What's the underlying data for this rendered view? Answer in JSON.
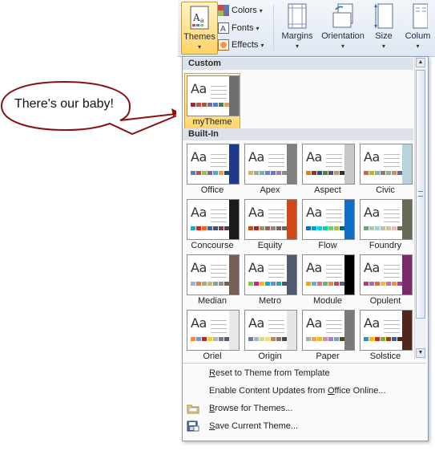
{
  "ribbon": {
    "themes_label": "Themes",
    "colors_label": "Colors",
    "fonts_label": "Fonts",
    "effects_label": "Effects",
    "margins_label": "Margins",
    "orientation_label": "Orientation",
    "size_label": "Size",
    "columns_label": "Colum"
  },
  "gallery": {
    "custom_header": "Custom",
    "builtin_header": "Built-In",
    "custom": [
      {
        "name": "myTheme",
        "strip": "#6e6e6e",
        "swatches": [
          "#9b2c2c",
          "#c0504d",
          "#9b5b3c",
          "#8064a2",
          "#4f81bd",
          "#4a7a55",
          "#e0a060"
        ]
      }
    ],
    "builtin": [
      {
        "name": "Office",
        "strip": "#1f3a8a",
        "swatches": [
          "#4f81bd",
          "#c0504d",
          "#9bbb59",
          "#8064a2",
          "#4bacc6",
          "#f79646",
          "#1f497d"
        ]
      },
      {
        "name": "Apex",
        "strip": "#7f7f7f",
        "swatches": [
          "#ceb966",
          "#9cb084",
          "#6bb1c9",
          "#6585cf",
          "#7e6bc9",
          "#a379bb",
          "#8a8a8a"
        ]
      },
      {
        "name": "Aspect",
        "strip": "#c8c8c8",
        "swatches": [
          "#f07f09",
          "#9f2936",
          "#1b587c",
          "#4e8542",
          "#604878",
          "#c19859",
          "#323232"
        ]
      },
      {
        "name": "Civic",
        "strip": "#b9d3dc",
        "swatches": [
          "#d16349",
          "#ccb400",
          "#8cadae",
          "#8c7b70",
          "#8fb08c",
          "#d19049",
          "#646b86"
        ]
      },
      {
        "name": "Concourse",
        "strip": "#1a1a1a",
        "swatches": [
          "#2da2bf",
          "#da1f28",
          "#eb641b",
          "#39639d",
          "#474b78",
          "#7d3c4a",
          "#464646"
        ]
      },
      {
        "name": "Equity",
        "strip": "#d34817",
        "swatches": [
          "#d34817",
          "#9b2d1f",
          "#a28e6a",
          "#956251",
          "#918485",
          "#855d5d",
          "#696464"
        ]
      },
      {
        "name": "Flow",
        "strip": "#0f6fc6",
        "swatches": [
          "#0f6fc6",
          "#009dd9",
          "#0bd0d9",
          "#10cf9b",
          "#7cca62",
          "#a5c249",
          "#04617b"
        ]
      },
      {
        "name": "Foundry",
        "strip": "#676a55",
        "swatches": [
          "#72a376",
          "#b0ccb0",
          "#a8cdd7",
          "#c0beaf",
          "#cec597",
          "#e8b7b7",
          "#676a55"
        ]
      },
      {
        "name": "Median",
        "strip": "#775f55",
        "swatches": [
          "#94b6d2",
          "#dd8047",
          "#a5ab81",
          "#d8b25c",
          "#7ba79d",
          "#968c8c",
          "#775f55"
        ]
      },
      {
        "name": "Metro",
        "strip": "#4e5b6f",
        "swatches": [
          "#7fd13b",
          "#ea157a",
          "#feb80a",
          "#00addc",
          "#738ac8",
          "#1ab39f",
          "#4e5b6f"
        ]
      },
      {
        "name": "Module",
        "strip": "#000000",
        "swatches": [
          "#f0ad00",
          "#60b5cc",
          "#e66c7d",
          "#6bb76d",
          "#e88651",
          "#c64847",
          "#5a6378"
        ]
      },
      {
        "name": "Opulent",
        "strip": "#7a2a6a",
        "swatches": [
          "#b83d68",
          "#ac66bb",
          "#de6c36",
          "#f9b639",
          "#cf6da4",
          "#fa8d3d",
          "#b13f9a"
        ]
      },
      {
        "name": "Oriel",
        "strip": "#e8e8e8",
        "swatches": [
          "#fe8637",
          "#7598d9",
          "#b32c16",
          "#f5cd2d",
          "#aebad5",
          "#777c84",
          "#575f6d"
        ]
      },
      {
        "name": "Origin",
        "strip": "#e6e6e6",
        "swatches": [
          "#727ca3",
          "#9fb8cd",
          "#d2da7a",
          "#fada7a",
          "#b88472",
          "#8e736a",
          "#464653"
        ]
      },
      {
        "name": "Paper",
        "strip": "#7a7a7a",
        "swatches": [
          "#a5b592",
          "#f3a447",
          "#e7bc29",
          "#d092a7",
          "#9c85c0",
          "#809ec2",
          "#444d26"
        ]
      },
      {
        "name": "Solstice",
        "strip": "#4f271c",
        "swatches": [
          "#3891a7",
          "#feb80a",
          "#c32d2e",
          "#84aa33",
          "#964305",
          "#475a8d",
          "#4f271c"
        ]
      }
    ]
  },
  "menu": {
    "reset_prefix": "",
    "reset_key": "R",
    "reset_rest": "eset to Theme from Template",
    "enable_prefix": "Enable Content Updates from ",
    "enable_key": "O",
    "enable_rest": "ffice Online...",
    "browse_prefix": "",
    "browse_key": "B",
    "browse_rest": "rowse for Themes...",
    "save_prefix": "",
    "save_key": "S",
    "save_rest": "ave Current Theme..."
  },
  "callout": {
    "text": "There's our baby!"
  }
}
